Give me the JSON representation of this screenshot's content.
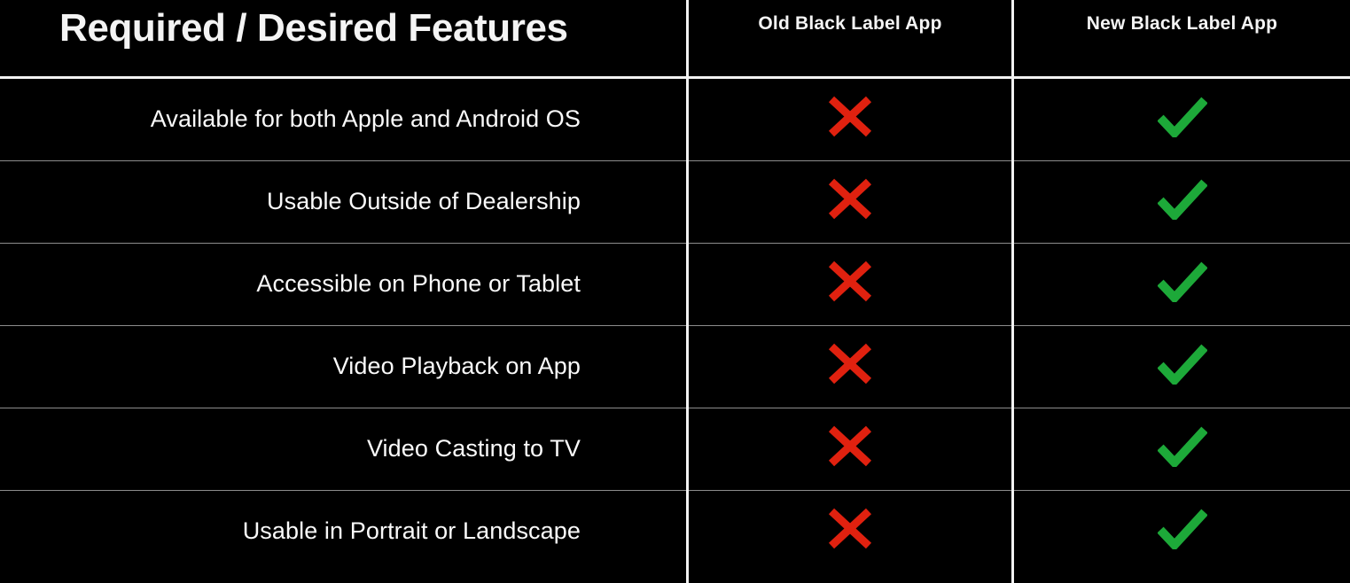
{
  "table": {
    "title": "Required / Desired Features",
    "columns": [
      {
        "key": "feature",
        "label": "Required / Desired Features"
      },
      {
        "key": "old_app",
        "label": "Old Black Label App"
      },
      {
        "key": "new_app",
        "label": "New Black Label App"
      }
    ],
    "rows": [
      {
        "feature": "Available for both Apple and Android OS",
        "old_app": "cross-icon",
        "new_app": "check-icon"
      },
      {
        "feature": "Usable Outside of Dealership",
        "old_app": "cross-icon",
        "new_app": "check-icon"
      },
      {
        "feature": "Accessible on Phone or Tablet",
        "old_app": "cross-icon",
        "new_app": "check-icon"
      },
      {
        "feature": "Video Playback on App",
        "old_app": "cross-icon",
        "new_app": "check-icon"
      },
      {
        "feature": "Video Casting to TV",
        "old_app": "cross-icon",
        "new_app": "check-icon"
      },
      {
        "feature": "Usable in Portrait or Landscape",
        "old_app": "cross-icon",
        "new_app": "check-icon"
      }
    ]
  },
  "colors": {
    "background": "#000000",
    "text": "#fafafa",
    "divider": "#f2f2f2",
    "row_separator": "#8c8c8c",
    "cross_red": "#e0210f",
    "check_green": "#1da939"
  }
}
